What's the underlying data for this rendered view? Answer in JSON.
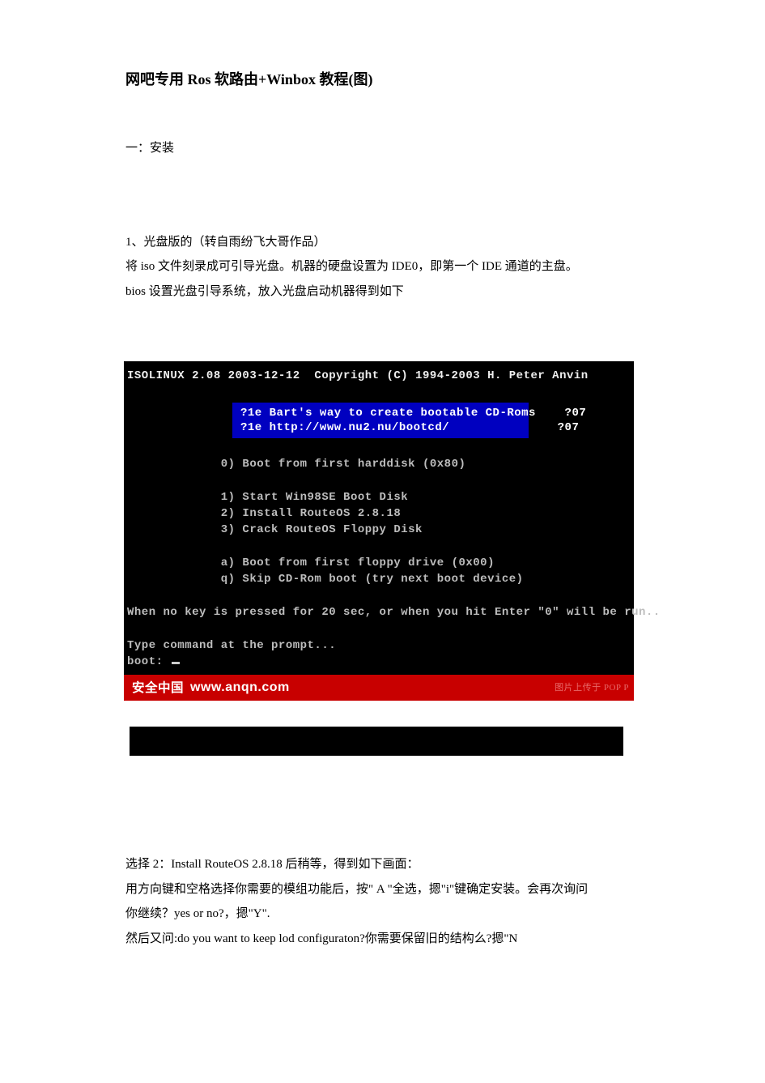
{
  "title": "网吧专用 Ros 软路由+Winbox 教程(图)",
  "section_heading": "一：安装",
  "intro_lines": [
    "1、光盘版的（转自雨纷飞大哥作品）",
    "将 iso 文件刻录成可引导光盘。机器的硬盘设置为 IDE0，即第一个 IDE 通道的主盘。",
    "bios 设置光盘引导系统，放入光盘启动机器得到如下"
  ],
  "terminal": {
    "header": "ISOLINUX 2.08 2003-12-12  Copyright (C) 1994-2003 H. Peter Anvin",
    "banner": [
      "?1e Bart's way to create bootable CD-Roms    ?07",
      "?1e http://www.nu2.nu/bootcd/               ?07"
    ],
    "menu": [
      "0) Boot from first harddisk (0x80)",
      "",
      "1) Start Win98SE Boot Disk",
      "2) Install RouteOS 2.8.18",
      "3) Crack RouteOS Floppy Disk",
      "",
      "a) Boot from first floppy drive (0x00)",
      "q) Skip CD-Rom boot (try next boot device)"
    ],
    "tail": [
      "When no key is pressed for 20 sec, or when you hit Enter \"0\" will be run..",
      "",
      "Type command at the prompt..."
    ],
    "prompt": "boot: ",
    "footer_site": "安全中国",
    "footer_url": "www.anqn.com",
    "footer_right": "图片上传于 POP P"
  },
  "outro_lines": [
    "选择 2：Install RouteOS 2.8.18 后稍等，得到如下画面：",
    "用方向键和空格选择你需要的模组功能后，按\" A \"全选，摁\"i\"键确定安装。会再次询问",
    "你继续？yes or no?，摁\"Y\".",
    "然后又问:do you want to keep lod configuraton?你需要保留旧的结构么?摁\"N"
  ]
}
